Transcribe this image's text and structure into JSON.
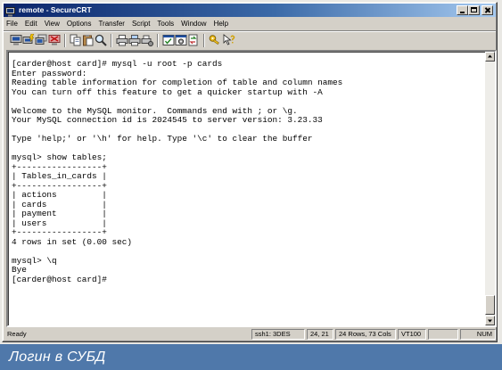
{
  "window": {
    "title": "remote - SecureCRT",
    "app_icon": "terminal-app-icon",
    "controls": [
      "minimize-icon",
      "maximize-icon",
      "close-icon"
    ]
  },
  "menu": {
    "items": [
      "File",
      "Edit",
      "View",
      "Options",
      "Transfer",
      "Script",
      "Tools",
      "Window",
      "Help"
    ]
  },
  "toolbar": {
    "icons": [
      "connect-icon",
      "quick-connect-icon",
      "connect-in-tab-icon",
      "disconnect-icon",
      "copy-icon",
      "paste-icon",
      "find-icon",
      "print-icon",
      "print-selection-icon",
      "print-setup-icon",
      "session-options-icon",
      "global-options-icon",
      "sftp-icon",
      "keymap-icon",
      "help-icon"
    ]
  },
  "terminal": {
    "lines": [
      "[carder@host card]# mysql -u root -p cards",
      "Enter password:",
      "Reading table information for completion of table and column names",
      "You can turn off this feature to get a quicker startup with -A",
      "",
      "Welcome to the MySQL monitor.  Commands end with ; or \\g.",
      "Your MySQL connection id is 2024545 to server version: 3.23.33",
      "",
      "Type 'help;' or '\\h' for help. Type '\\c' to clear the buffer",
      "",
      "mysql> show tables;",
      "+-----------------+",
      "| Tables_in_cards |",
      "+-----------------+",
      "| actions         |",
      "| cards           |",
      "| payment         |",
      "| users           |",
      "+-----------------+",
      "4 rows in set (0.00 sec)",
      "",
      "mysql> \\q",
      "Bye",
      "[carder@host card]#"
    ]
  },
  "status_bar": {
    "state": "Ready",
    "cipher": "ssh1: 3DES",
    "cursor_position": "24, 21",
    "dimensions": "24 Rows, 73 Cols",
    "emulation": "VT100",
    "num_lock": "NUM"
  },
  "caption": "Логин в СУБД",
  "colors": {
    "title_bar_start": "#0a246a",
    "title_bar_end": "#a6caf0",
    "window_face": "#d4d0c8",
    "terminal_background": "#ffffff",
    "terminal_text": "#000000",
    "caption_background": "#4f78aa",
    "caption_text": "#ffffff"
  }
}
